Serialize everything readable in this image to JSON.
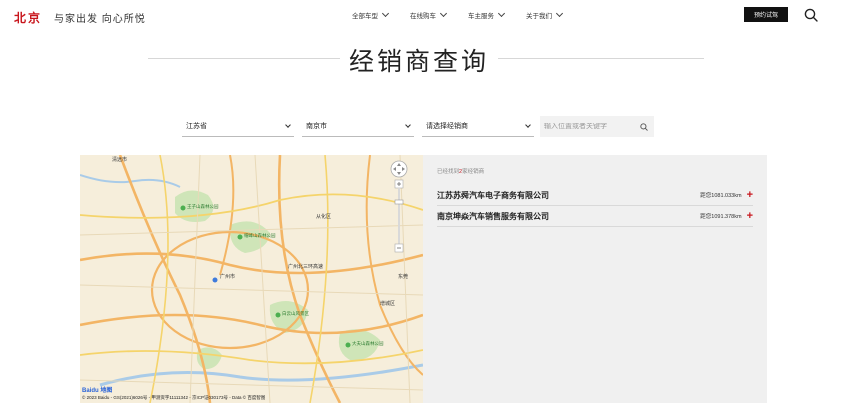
{
  "header": {
    "logo": "北京",
    "slogan": "与家出发  向心所悦",
    "nav": [
      {
        "label": "全部车型"
      },
      {
        "label": "在线购车"
      },
      {
        "label": "车主服务"
      },
      {
        "label": "关于我们"
      }
    ],
    "test_drive": "预约试驾"
  },
  "page": {
    "title": "经销商查询"
  },
  "filters": {
    "province": "江苏省",
    "city": "南京市",
    "dealer": "请选择经销商",
    "search_placeholder": "输入位置或者关键字"
  },
  "map": {
    "labels": [
      {
        "text": "清远市"
      },
      {
        "text": "从化区"
      },
      {
        "text": "广州市"
      },
      {
        "text": "增城区"
      },
      {
        "text": "东莞"
      },
      {
        "text": "广州北三环高速"
      }
    ],
    "parks": [
      {
        "text": "王子山森林公园"
      },
      {
        "text": "帽峰山森林公园"
      },
      {
        "text": "白云山风景区"
      },
      {
        "text": "大夫山森林公园"
      }
    ],
    "logo": "Baidu 地图",
    "copyright": "© 2023 Baidu - GS(2021)6026号 - 甲测资字11111342 - 京ICP证030173号 - Data © 百度智图"
  },
  "results": {
    "found_prefix": "已经找到",
    "found_count": "2",
    "found_suffix": "家经销商",
    "dealers": [
      {
        "name": "江苏苏舜汽车电子商务有限公司",
        "distance": "距您1081.033km"
      },
      {
        "name": "南京坤焱汽车销售服务有限公司",
        "distance": "距您1091.378km"
      }
    ]
  },
  "colors": {
    "brand": "#c8161d",
    "button": "#111111",
    "panel_bg": "#f0f0f0",
    "map_bg": "#f6eedb"
  }
}
